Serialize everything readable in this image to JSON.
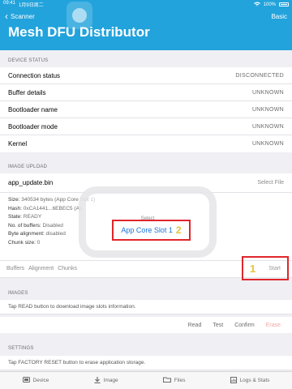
{
  "status_bar": {
    "time": "09:41",
    "date": "1月9日周二",
    "battery": "100%"
  },
  "nav": {
    "back_label": "Scanner",
    "right_label": "Basic",
    "title": "Mesh DFU Distributor"
  },
  "device_status": {
    "header": "DEVICE STATUS",
    "rows": [
      {
        "label": "Connection status",
        "value": "DISCONNECTED"
      },
      {
        "label": "Buffer details",
        "value": "UNKNOWN"
      },
      {
        "label": "Bootloader name",
        "value": "UNKNOWN"
      },
      {
        "label": "Bootloader mode",
        "value": "UNKNOWN"
      },
      {
        "label": "Kernel",
        "value": "UNKNOWN"
      }
    ]
  },
  "image_upload": {
    "header": "IMAGE UPLOAD",
    "file_name": "app_update.bin",
    "select_file": "Select File",
    "details": [
      {
        "label": "Size:",
        "value": "340534 bytes (App Core Slot 1)"
      },
      {
        "label": "Hash:",
        "value": "0xCA1441...6EBEC5 (Ap"
      },
      {
        "label": "State:",
        "value": "READY"
      },
      {
        "label": "No. of buffers:",
        "value": "Disabled"
      },
      {
        "label": "Byte alignment:",
        "value": "disabled"
      },
      {
        "label": "Chunk size:",
        "value": "0"
      }
    ],
    "segments": [
      "Buffers",
      "Alignment",
      "Chunks"
    ],
    "start_label": "Start",
    "annotation_1": "1"
  },
  "popup": {
    "title": "Select",
    "option": "App Core Slot 1",
    "annotation_2": "2"
  },
  "images": {
    "header": "IMAGES",
    "info": "Tap READ button to download image slots information.",
    "actions": [
      "Read",
      "Test",
      "Confirm",
      "Erase"
    ]
  },
  "settings": {
    "header": "SETTINGS",
    "info": "Tap FACTORY RESET button to erase application storage."
  },
  "tabbar": [
    {
      "label": "Device",
      "icon": "device-icon"
    },
    {
      "label": "Image",
      "icon": "download-icon"
    },
    {
      "label": "Files",
      "icon": "folder-icon"
    },
    {
      "label": "Logs & Stats",
      "icon": "stats-icon"
    }
  ],
  "colors": {
    "header": "#22a3dc",
    "highlight": "#e0262c",
    "annotation": "#e7c33a",
    "link": "#1a73d9"
  }
}
